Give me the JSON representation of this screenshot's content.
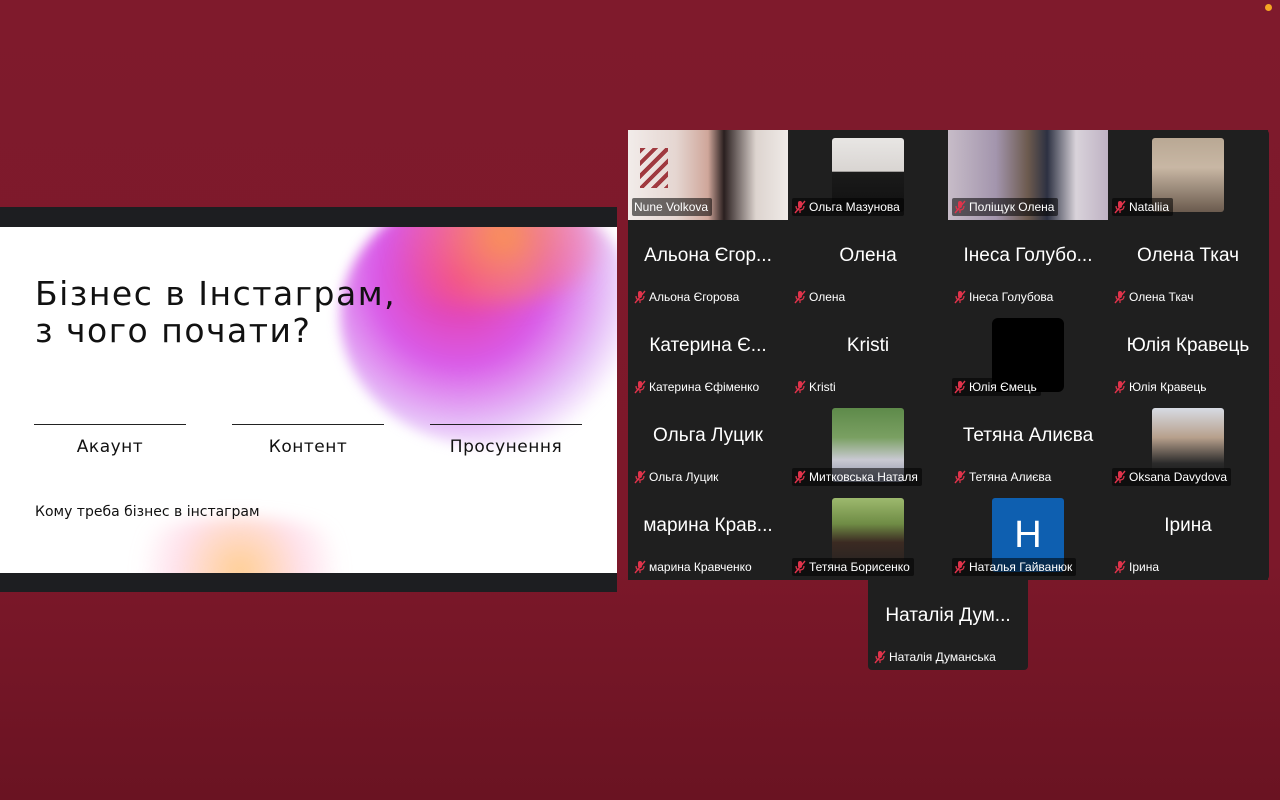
{
  "slide": {
    "title_line1": "Бізнес в Інстаграм,",
    "title_line2": "з чого почати?",
    "columns": [
      "Акаунт",
      "Контент",
      "Просунення"
    ],
    "footer": "Кому треба бізнес в інстаграм"
  },
  "participants": [
    {
      "name": "Nune Volkova",
      "display": "",
      "kind": "video",
      "active": true
    },
    {
      "name": "Ольга Мазунова",
      "display": "",
      "kind": "photo"
    },
    {
      "name": "Поліщук Олена",
      "display": "",
      "kind": "video"
    },
    {
      "name": "Nataliia",
      "display": "",
      "kind": "photo"
    },
    {
      "name": "Альона Єгорова",
      "display": "Альона Єгор...",
      "kind": "name"
    },
    {
      "name": "Олена",
      "display": "Олена",
      "kind": "name"
    },
    {
      "name": "Інеса Голубова",
      "display": "Інеса Голубо...",
      "kind": "name"
    },
    {
      "name": "Олена Ткач",
      "display": "Олена Ткач",
      "kind": "name"
    },
    {
      "name": "Катерина Єфіменко",
      "display": "Катерина Є...",
      "kind": "name"
    },
    {
      "name": "Kristi",
      "display": "Kristi",
      "kind": "name"
    },
    {
      "name": "Юлія Ємець",
      "display": "",
      "kind": "black"
    },
    {
      "name": "Юлія Кравець",
      "display": "Юлія Кравець",
      "kind": "name"
    },
    {
      "name": "Ольга Луцик",
      "display": "Ольга Луцик",
      "kind": "name"
    },
    {
      "name": "Митковська Наталя",
      "display": "",
      "kind": "photo"
    },
    {
      "name": "Тетяна Алиєва",
      "display": "Тетяна Алиєва",
      "kind": "name"
    },
    {
      "name": "Oksana Davydova",
      "display": "",
      "kind": "photo"
    },
    {
      "name": "марина Кравченко",
      "display": "марина Крав...",
      "kind": "name"
    },
    {
      "name": "Тетяна Борисенко",
      "display": "",
      "kind": "photo"
    },
    {
      "name": "Наталья Гайванюк",
      "display": "",
      "kind": "letter",
      "letter": "H"
    },
    {
      "name": "Ірина",
      "display": "Ірина",
      "kind": "name"
    }
  ],
  "extra_participant": {
    "name": "Наталія Думанська",
    "display": "Наталія Дум..."
  },
  "colors": {
    "background": "#7f1a2c",
    "active_border": "#23d160",
    "muted_icon": "#e0334b",
    "avatar_blue": "#0e5fb0"
  }
}
